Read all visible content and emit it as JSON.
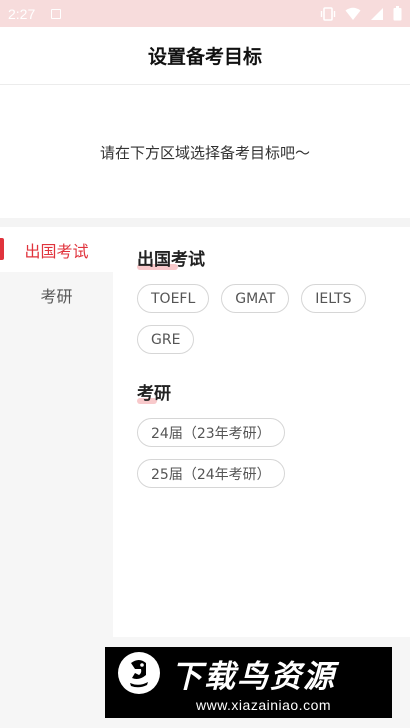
{
  "status_bar": {
    "time": "2:27",
    "icons": [
      "notification-icon",
      "vibrate-icon",
      "wifi-icon",
      "signal-icon",
      "battery-icon"
    ]
  },
  "header": {
    "title": "设置备考目标"
  },
  "intro": {
    "text": "请在下方区域选择备考目标吧～"
  },
  "sidebar": {
    "items": [
      {
        "label": "出国考试",
        "active": true
      },
      {
        "label": "考研",
        "active": false
      }
    ]
  },
  "sections": [
    {
      "title": "出国考试",
      "tags": [
        "TOEFL",
        "GMAT",
        "IELTS",
        "GRE"
      ]
    },
    {
      "title": "考研",
      "tags": [
        "24届（23年考研）",
        "25届（24年考研）"
      ]
    }
  ],
  "watermark": {
    "title": "下载鸟资源",
    "url": "www.xiazainiao.com"
  },
  "colors": {
    "accent": "#e0333c",
    "status_bar": "#f7dcdc",
    "title_mark": "#f8c9cb"
  }
}
